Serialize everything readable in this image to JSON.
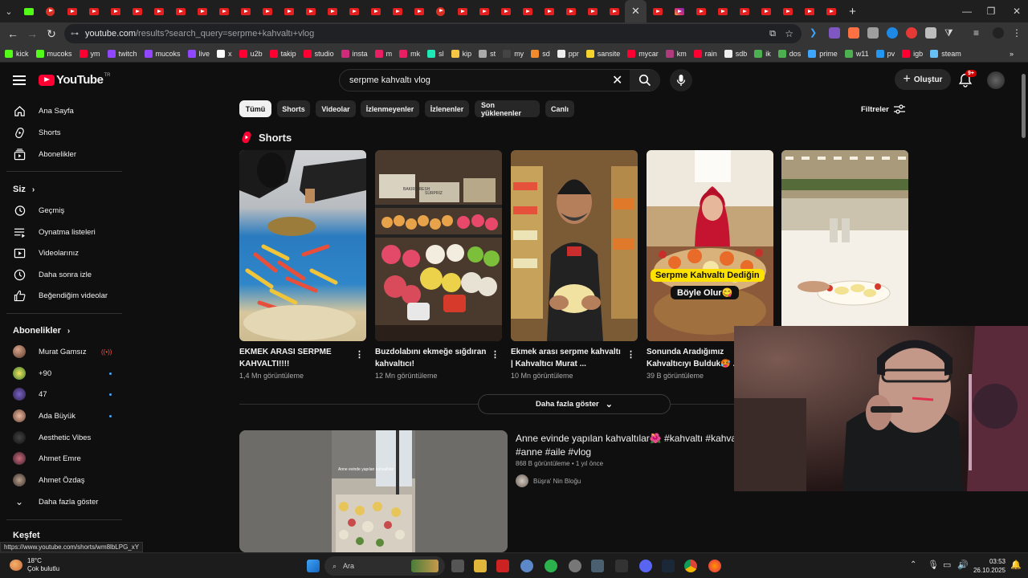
{
  "browser": {
    "tabs_count": 42,
    "url_host": "youtube.com",
    "url_path": "/results?search_query=serpme+kahvaltı+vlog",
    "bookmarks": [
      {
        "label": "kick",
        "color": "#53fc18"
      },
      {
        "label": "mucoks",
        "color": "#53fc18"
      },
      {
        "label": "ym",
        "color": "#ff0033"
      },
      {
        "label": "twitch",
        "color": "#9146ff"
      },
      {
        "label": "mucoks",
        "color": "#9146ff"
      },
      {
        "label": "live",
        "color": "#9146ff"
      },
      {
        "label": "x",
        "color": "#ffffff"
      },
      {
        "label": "u2b",
        "color": "#ff0033"
      },
      {
        "label": "takip",
        "color": "#ff0033"
      },
      {
        "label": "studio",
        "color": "#ff0033"
      },
      {
        "label": "insta",
        "color": "#d02a7b"
      },
      {
        "label": "m",
        "color": "#e91e63"
      },
      {
        "label": "mk",
        "color": "#e91e63"
      },
      {
        "label": "sl",
        "color": "#1de9b6"
      },
      {
        "label": "kip",
        "color": "#f6c744"
      },
      {
        "label": "st",
        "color": "#aaaaaa"
      },
      {
        "label": "my",
        "color": "#444444"
      },
      {
        "label": "sd",
        "color": "#f28b2c"
      },
      {
        "label": "ppr",
        "color": "#eeeeee"
      },
      {
        "label": "sansite",
        "color": "#f6d32d"
      },
      {
        "label": "mycar",
        "color": "#ff0033"
      },
      {
        "label": "km",
        "color": "#b03a7c"
      },
      {
        "label": "rain",
        "color": "#ff0033"
      },
      {
        "label": "sdb",
        "color": "#eeeeee"
      },
      {
        "label": "ik",
        "color": "#4caf50"
      },
      {
        "label": "dos",
        "color": "#4caf50"
      },
      {
        "label": "prime",
        "color": "#3ea6ff"
      },
      {
        "label": "w11",
        "color": "#4caf50"
      },
      {
        "label": "pv",
        "color": "#2196f3"
      },
      {
        "label": "igb",
        "color": "#ff0033"
      },
      {
        "label": "steam",
        "color": "#66c0f4"
      }
    ],
    "more_bookmarks": "»"
  },
  "youtube": {
    "logo_text": "YouTube",
    "logo_sup": "TR",
    "search_value": "serpme kahvaltı vlog",
    "create_label": "Oluştur",
    "notif_badge": "9+",
    "accent": "#ff0033"
  },
  "sidebar": {
    "main": [
      {
        "label": "Ana Sayfa",
        "icon": "home-icon"
      },
      {
        "label": "Shorts",
        "icon": "shorts-icon"
      },
      {
        "label": "Abonelikler",
        "icon": "subscriptions-icon"
      }
    ],
    "you_header": "Siz",
    "you": [
      {
        "label": "Geçmiş",
        "icon": "history-icon"
      },
      {
        "label": "Oynatma listeleri",
        "icon": "playlists-icon"
      },
      {
        "label": "Videolarınız",
        "icon": "your-videos-icon"
      },
      {
        "label": "Daha sonra izle",
        "icon": "watch-later-icon"
      },
      {
        "label": "Beğendiğim videolar",
        "icon": "liked-icon"
      }
    ],
    "subs_header": "Abonelikler",
    "subs": [
      {
        "label": "Murat Gamsız",
        "indicator": "live"
      },
      {
        "label": "+90",
        "indicator": "dot"
      },
      {
        "label": "47",
        "indicator": "dot"
      },
      {
        "label": "Ada Büyük",
        "indicator": "dot"
      },
      {
        "label": "Aesthetic Vibes",
        "indicator": ""
      },
      {
        "label": "Ahmet Emre",
        "indicator": ""
      },
      {
        "label": "Ahmet Özdaş",
        "indicator": ""
      }
    ],
    "show_more": "Daha fazla göster",
    "explore_header": "Keşfet"
  },
  "chips": [
    "Tümü",
    "Shorts",
    "Videolar",
    "İzlenmeyenler",
    "İzlenenler",
    "Son yüklenenler",
    "Canlı"
  ],
  "filters_label": "Filtreler",
  "shorts": {
    "title": "Shorts",
    "items": [
      {
        "title": "EKMEK ARASI SERPME KAHVALTI!!!!",
        "views": "1,4 Mn görüntüleme"
      },
      {
        "title": "Buzdolabını ekmeğe sığdıran kahvaltıcı!",
        "views": "12 Mn görüntüleme"
      },
      {
        "title": "Ekmek arası serpme kahvaltı | Kahvaltıcı Murat ...",
        "views": "10 Mn görüntüleme"
      },
      {
        "title": "Sonunda Aradığımız Kahvaltıcıyı Bulduk🥵 ...",
        "views": "39 B görüntüleme"
      },
      {
        "title": "",
        "views": ""
      }
    ],
    "overlay_1": "Serpme Kahvaltı Dediğin",
    "overlay_2": "Böyle Olur😋",
    "sign_1": "BAKIR FRESH",
    "sign_2": "SÜRPRİZ",
    "video_overlay": "Anne evinde yapılan kahvaltılar"
  },
  "show_more_label": "Daha fazla göster",
  "video": {
    "title": "Anne evinde yapılan kahvaltılar🌺 #kahvaltı #kahvaltı #anne #aile #vlog",
    "views": "868 B görüntüleme",
    "age": "1 yıl önce",
    "channel": "Büşra' Nin Bloğu"
  },
  "status_url": "https://www.youtube.com/shorts/wm8lbLPG_xY",
  "taskbar": {
    "temp": "18°C",
    "weather": "Çok bulutlu",
    "search": "Ara",
    "time": "03:53",
    "date": "26.10.2025"
  }
}
